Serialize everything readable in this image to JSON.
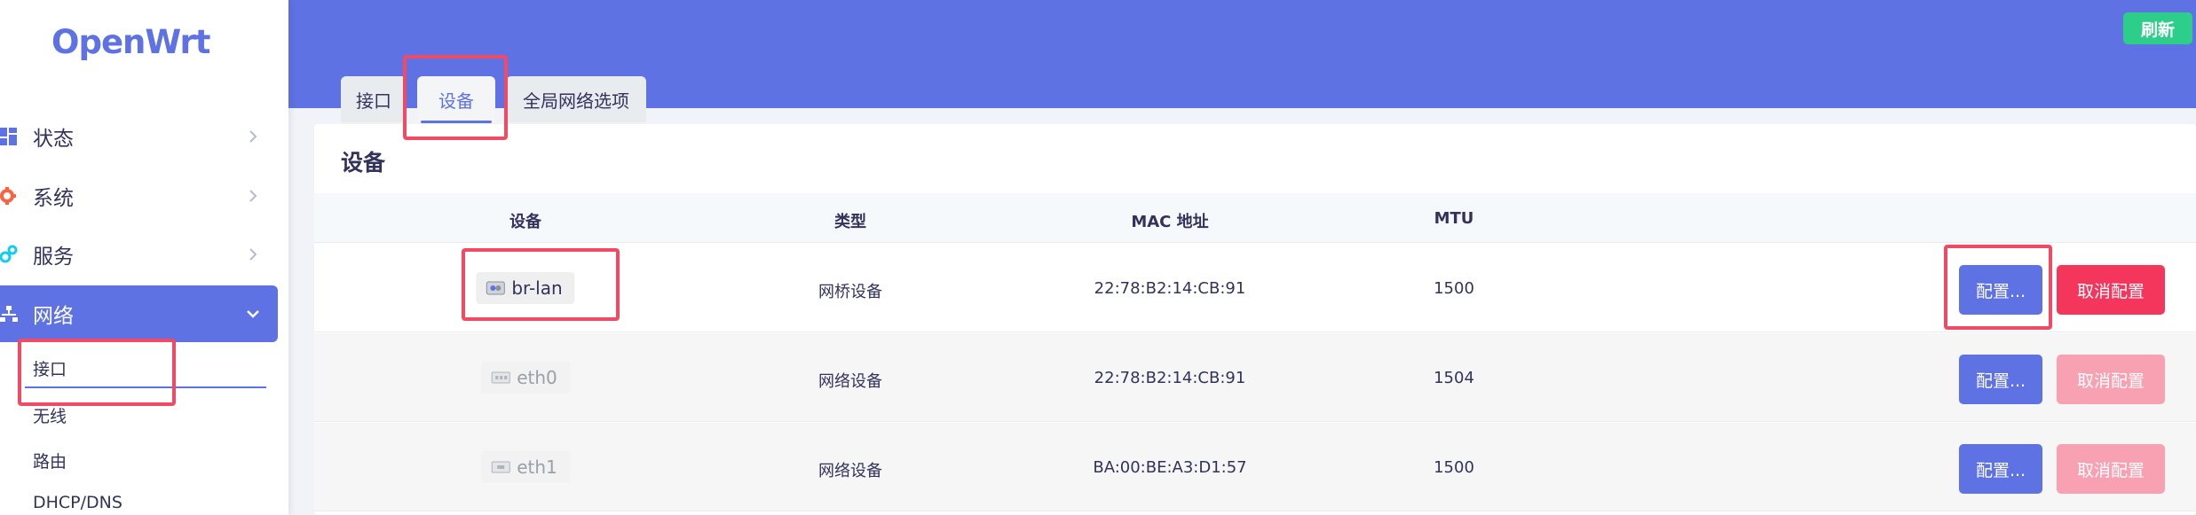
{
  "app": {
    "logo": "OpenWrt"
  },
  "sidebar": {
    "items": [
      {
        "label": "状态",
        "icon": "dashboard-icon",
        "color": "#5e72e4"
      },
      {
        "label": "系统",
        "icon": "gear-icon",
        "color": "#fb6340"
      },
      {
        "label": "服务",
        "icon": "gears-icon",
        "color": "#11cdef"
      },
      {
        "label": "网络",
        "icon": "network-icon",
        "color": "#ffffff",
        "active": true
      }
    ],
    "subitems": [
      "接口",
      "无线",
      "路由",
      "DHCP/DNS"
    ]
  },
  "header": {
    "refresh_label": "刷新",
    "tabs": [
      {
        "label": "接口"
      },
      {
        "label": "设备",
        "active": true
      },
      {
        "label": "全局网络选项"
      }
    ]
  },
  "card": {
    "title": "设备",
    "columns": [
      "设备",
      "类型",
      "MAC 地址",
      "MTU"
    ],
    "rows": [
      {
        "device": "br-lan",
        "type": "网桥设备",
        "mac": "22:78:B2:14:CB:91",
        "mtu": "1500",
        "config": "配置...",
        "unconfig": "取消配置",
        "unconfig_enabled": true
      },
      {
        "device": "eth0",
        "type": "网络设备",
        "mac": "22:78:B2:14:CB:91",
        "mtu": "1504",
        "config": "配置...",
        "unconfig": "取消配置",
        "unconfig_enabled": false
      },
      {
        "device": "eth1",
        "type": "网络设备",
        "mac": "BA:00:BE:A3:D1:57",
        "mtu": "1500",
        "config": "配置...",
        "unconfig": "取消配置",
        "unconfig_enabled": false
      }
    ]
  },
  "colors": {
    "primary": "#5e72e4",
    "success": "#2dce89",
    "danger": "#f5365c",
    "danger_disabled": "#f7a1b3",
    "highlight": "#f04a64"
  }
}
